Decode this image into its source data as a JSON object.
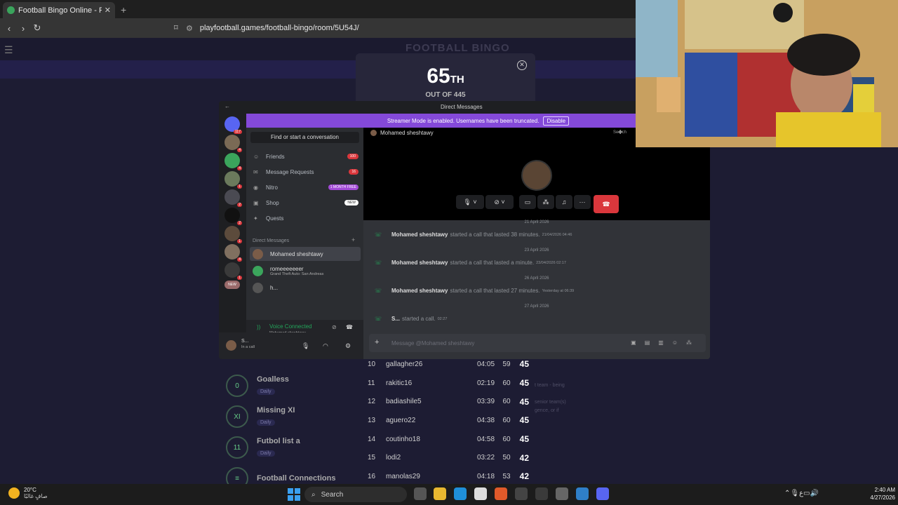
{
  "browser": {
    "tab_title": "Football Bingo Online - Play No",
    "url": "playfootball.games/football-bingo/room/5U54J/"
  },
  "site": {
    "brand": "FOOTBALL BINGO",
    "result": {
      "rank": "65",
      "suffix": "TH",
      "out_of": "OUT OF 445"
    },
    "games": [
      {
        "name": "Goalless",
        "sub": "Daily",
        "icon": "0"
      },
      {
        "name": "Missing XI",
        "sub": "Daily",
        "icon": "XI"
      },
      {
        "name": "Futbol list a",
        "sub": "Daily",
        "icon": "11"
      },
      {
        "name": "Football Connections",
        "sub": "Daily",
        "icon": "≡"
      }
    ],
    "notes": [
      "t team - being",
      "senior team(s)",
      "gence, or if"
    ],
    "leaderboard": [
      {
        "rank": "10",
        "name": "gallagher26",
        "time": "04:05",
        "score": "59",
        "points": "45"
      },
      {
        "rank": "11",
        "name": "rakitic16",
        "time": "02:19",
        "score": "60",
        "points": "45"
      },
      {
        "rank": "12",
        "name": "badiashile5",
        "time": "03:39",
        "score": "60",
        "points": "45"
      },
      {
        "rank": "13",
        "name": "aguero22",
        "time": "04:38",
        "score": "60",
        "points": "45"
      },
      {
        "rank": "14",
        "name": "coutinho18",
        "time": "04:58",
        "score": "60",
        "points": "45"
      },
      {
        "rank": "15",
        "name": "lodi2",
        "time": "03:22",
        "score": "50",
        "points": "42"
      },
      {
        "rank": "16",
        "name": "manolas29",
        "time": "04:18",
        "score": "53",
        "points": "42"
      }
    ]
  },
  "discord": {
    "window_title": "Direct Messages",
    "streamer_text": "Streamer Mode is enabled. Usernames have been truncated.",
    "disable_label": "Disable",
    "find_conversation": "Find or start a conversation",
    "nav": [
      {
        "label": "Friends",
        "pill": "100",
        "icon": "friends-icon"
      },
      {
        "label": "Message Requests",
        "pill": "16",
        "icon": "mail-icon"
      },
      {
        "label": "Nitro",
        "pill": "1 MONTH FREE",
        "icon": "nitro-icon"
      },
      {
        "label": "Shop",
        "pill": "NEW",
        "icon": "shop-icon"
      },
      {
        "label": "Quests",
        "pill": "",
        "icon": "quests-icon"
      }
    ],
    "guild_badges": [
      "117",
      "4",
      "4",
      "1",
      "2",
      "2",
      "1",
      "4",
      "1",
      "3"
    ],
    "guild_new_label": "NEW",
    "dm_header": "Direct Messages",
    "dms": [
      {
        "name": "Mohamed sheshtawy",
        "sub": ""
      },
      {
        "name": "romeeeeeeer",
        "sub": "Grand Theft Auto: San Andreas"
      },
      {
        "name": "h...",
        "sub": ""
      }
    ],
    "voice": {
      "status": "Voice Connected",
      "who": "Mohamed sheshtawy"
    },
    "user": {
      "name": "S...",
      "status": "In a call"
    },
    "chat": {
      "peer": "Mohamed sheshtawy",
      "search_placeholder": "Search",
      "placeholder": "Message @Mohamed sheshtawy",
      "messages": [
        {
          "date": "21 April 2026",
          "who": "Mohamed sheshtawy",
          "action": "started a call that lasted 38 minutes.",
          "ts": "21/04/2026 04:46"
        },
        {
          "date": "23 April 2026",
          "who": "Mohamed sheshtawy",
          "action": "started a call that lasted a minute.",
          "ts": "23/04/2026 02:17"
        },
        {
          "date": "26 April 2026",
          "who": "Mohamed sheshtawy",
          "action": "started a call that lasted 27 minutes.",
          "ts": "Yesterday at 06:39"
        },
        {
          "date": "27 April 2026",
          "who": "S...",
          "action": "started a call.",
          "ts": "02:27"
        }
      ]
    }
  },
  "taskbar": {
    "temp": "20°C",
    "weather": "صافٍ غالبًا",
    "search": "Search",
    "time": "2:40 AM",
    "date": "4/27/2026",
    "lang": "ع"
  },
  "colors": {
    "accent": "#8449d9",
    "danger": "#da373c",
    "online": "#23a55a"
  }
}
